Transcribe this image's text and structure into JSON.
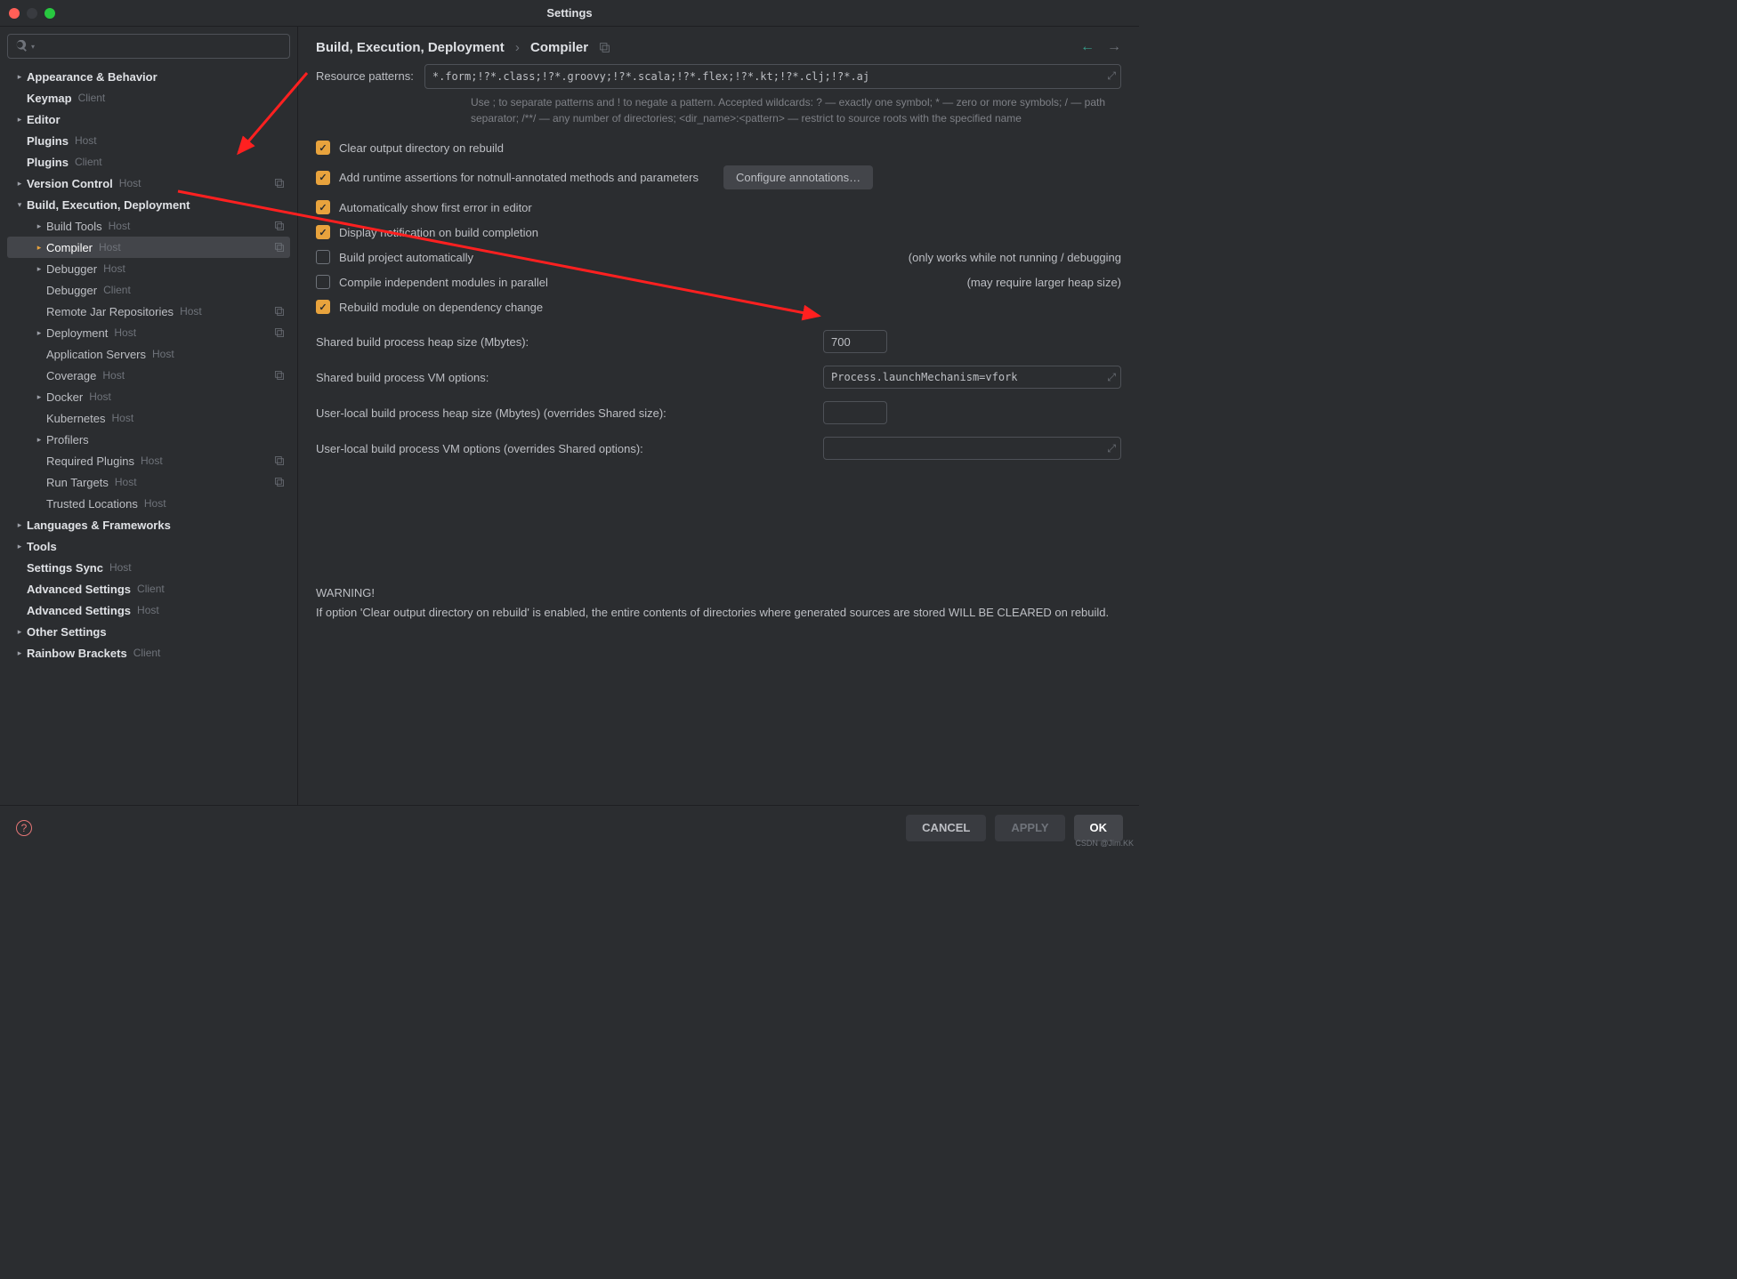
{
  "window": {
    "title": "Settings"
  },
  "breadcrumb": {
    "parent": "Build, Execution, Deployment",
    "sep": "›",
    "current": "Compiler"
  },
  "sidebar": {
    "search_placeholder": "",
    "items": [
      {
        "label": "Appearance & Behavior",
        "bold": true,
        "arrow": "collapsed",
        "indent": 0
      },
      {
        "label": "Keymap",
        "bold": true,
        "arrow": "none",
        "indent": 0,
        "tag": "Client"
      },
      {
        "label": "Editor",
        "bold": true,
        "arrow": "collapsed",
        "indent": 0
      },
      {
        "label": "Plugins",
        "bold": true,
        "arrow": "none",
        "indent": 0,
        "tag": "Host"
      },
      {
        "label": "Plugins",
        "bold": true,
        "arrow": "none",
        "indent": 0,
        "tag": "Client"
      },
      {
        "label": "Version Control",
        "bold": true,
        "arrow": "collapsed",
        "indent": 0,
        "tag": "Host",
        "stack": true
      },
      {
        "label": "Build, Execution, Deployment",
        "bold": true,
        "arrow": "expanded",
        "indent": 0
      },
      {
        "label": "Build Tools",
        "arrow": "collapsed",
        "indent": 1,
        "tag": "Host",
        "stack": true
      },
      {
        "label": "Compiler",
        "arrow": "active",
        "indent": 1,
        "tag": "Host",
        "stack": true,
        "selected": true
      },
      {
        "label": "Debugger",
        "arrow": "collapsed",
        "indent": 1,
        "tag": "Host"
      },
      {
        "label": "Debugger",
        "arrow": "none",
        "indent": 1,
        "tag": "Client"
      },
      {
        "label": "Remote Jar Repositories",
        "arrow": "none",
        "indent": 1,
        "tag": "Host",
        "stack": true
      },
      {
        "label": "Deployment",
        "arrow": "collapsed",
        "indent": 1,
        "tag": "Host",
        "stack": true
      },
      {
        "label": "Application Servers",
        "arrow": "none",
        "indent": 1,
        "tag": "Host"
      },
      {
        "label": "Coverage",
        "arrow": "none",
        "indent": 1,
        "tag": "Host",
        "stack": true
      },
      {
        "label": "Docker",
        "arrow": "collapsed",
        "indent": 1,
        "tag": "Host"
      },
      {
        "label": "Kubernetes",
        "arrow": "none",
        "indent": 1,
        "tag": "Host"
      },
      {
        "label": "Profilers",
        "arrow": "collapsed",
        "indent": 1
      },
      {
        "label": "Required Plugins",
        "arrow": "none",
        "indent": 1,
        "tag": "Host",
        "stack": true
      },
      {
        "label": "Run Targets",
        "arrow": "none",
        "indent": 1,
        "tag": "Host",
        "stack": true
      },
      {
        "label": "Trusted Locations",
        "arrow": "none",
        "indent": 1,
        "tag": "Host"
      },
      {
        "label": "Languages & Frameworks",
        "bold": true,
        "arrow": "collapsed",
        "indent": 0
      },
      {
        "label": "Tools",
        "bold": true,
        "arrow": "collapsed",
        "indent": 0
      },
      {
        "label": "Settings Sync",
        "bold": true,
        "arrow": "none",
        "indent": 0,
        "tag": "Host"
      },
      {
        "label": "Advanced Settings",
        "bold": true,
        "arrow": "none",
        "indent": 0,
        "tag": "Client"
      },
      {
        "label": "Advanced Settings",
        "bold": true,
        "arrow": "none",
        "indent": 0,
        "tag": "Host"
      },
      {
        "label": "Other Settings",
        "bold": true,
        "arrow": "collapsed",
        "indent": 0
      },
      {
        "label": "Rainbow Brackets",
        "bold": true,
        "arrow": "collapsed",
        "indent": 0,
        "tag": "Client"
      }
    ]
  },
  "form": {
    "resource_patterns_label": "Resource patterns:",
    "resource_patterns_value": "*.form;!?*.class;!?*.groovy;!?*.scala;!?*.flex;!?*.kt;!?*.clj;!?*.aj",
    "resource_help": "Use ; to separate patterns and ! to negate a pattern. Accepted wildcards: ? — exactly one symbol; * — zero or more symbols; / — path separator; /**/ — any number of directories; <dir_name>:<pattern> — restrict to source roots with the specified name",
    "checks": [
      {
        "label": "Clear output directory on rebuild",
        "checked": true
      },
      {
        "label": "Add runtime assertions for notnull-annotated methods and parameters",
        "checked": true,
        "button": "Configure annotations…"
      },
      {
        "label": "Automatically show first error in editor",
        "checked": true
      },
      {
        "label": "Display notification on build completion",
        "checked": true
      },
      {
        "label": "Build project automatically",
        "checked": false,
        "note": "(only works while not running / debugging"
      },
      {
        "label": "Compile independent modules in parallel",
        "checked": false,
        "note": "(may require larger heap size)"
      },
      {
        "label": "Rebuild module on dependency change",
        "checked": true
      }
    ],
    "fields": [
      {
        "label": "Shared build process heap size (Mbytes):",
        "type": "num",
        "value": "700"
      },
      {
        "label": "Shared build process VM options:",
        "type": "text",
        "value": "Process.launchMechanism=vfork",
        "expand": true
      },
      {
        "label": "User-local build process heap size (Mbytes) (overrides Shared size):",
        "type": "num",
        "value": ""
      },
      {
        "label": "User-local build process VM options (overrides Shared options):",
        "type": "text",
        "value": "",
        "expand": true
      }
    ],
    "warning_head": "WARNING!",
    "warning_body": "If option 'Clear output directory on rebuild' is enabled, the entire contents of directories where generated sources are stored WILL BE CLEARED on rebuild."
  },
  "footer": {
    "cancel": "CANCEL",
    "apply": "APPLY",
    "ok": "OK"
  },
  "watermark": "CSDN @Jim.KK"
}
